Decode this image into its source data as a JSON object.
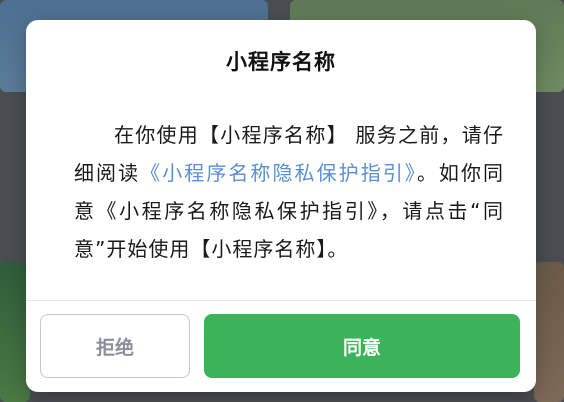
{
  "dialog": {
    "title": "小程序名称",
    "body": {
      "part1": "在你使用【小程序名称】 服务之前，请仔细阅读",
      "link": "《小程序名称隐私保护指引》",
      "part2": "。如你同意《小程序名称隐私保护指引》，请点击“同意”开始使用【小程序名称】。"
    },
    "buttons": {
      "reject_label": "拒绝",
      "agree_label": "同意"
    }
  },
  "colors": {
    "accent": "#3cb25a",
    "link": "#5a8fd6"
  }
}
